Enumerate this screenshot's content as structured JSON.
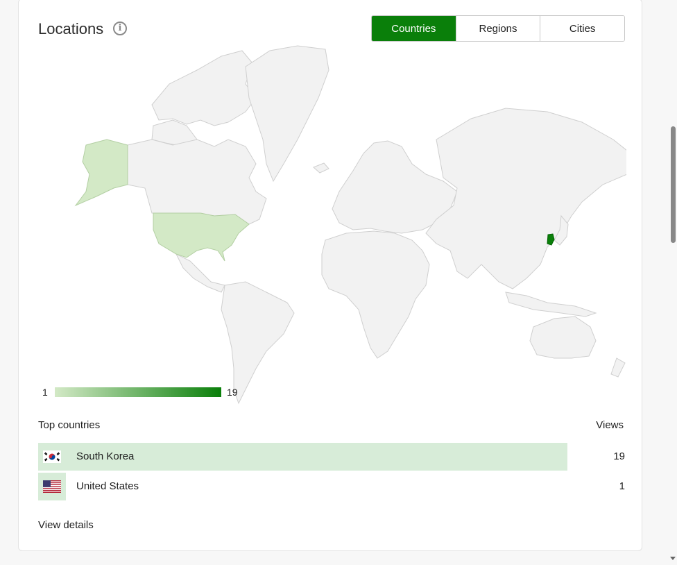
{
  "header": {
    "title": "Locations"
  },
  "tabs": [
    {
      "label": "Countries",
      "active": true
    },
    {
      "label": "Regions",
      "active": false
    },
    {
      "label": "Cities",
      "active": false
    }
  ],
  "legend": {
    "min": "1",
    "max": "19",
    "color_low": "#d3e9c6",
    "color_high": "#0a7f0a"
  },
  "table": {
    "header_left": "Top countries",
    "header_right": "Views",
    "rows": [
      {
        "country": "South Korea",
        "views": "19",
        "flag_icon": "south-korea-flag-icon"
      },
      {
        "country": "United States",
        "views": "1",
        "flag_icon": "united-states-flag-icon"
      }
    ]
  },
  "footer": {
    "view_details": "View details"
  },
  "colors": {
    "accent": "#0a7f0a",
    "row_highlight": "#d7ecd8",
    "map_land": "#f2f2f2",
    "map_border": "#cfcfcf"
  }
}
